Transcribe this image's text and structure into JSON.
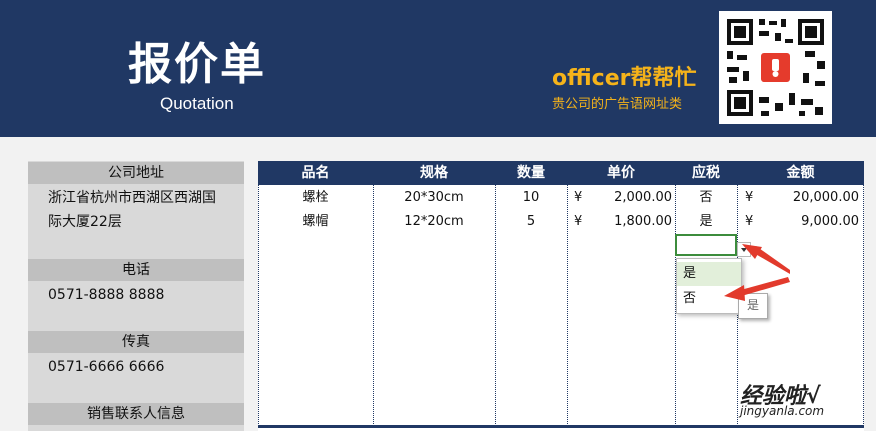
{
  "header": {
    "title_cn": "报价单",
    "title_en": "Quotation",
    "brand": "officer帮帮忙",
    "slogan": "贵公司的广告语网址类",
    "brand_color": "#f5b31a",
    "bg_color": "#203864"
  },
  "left": {
    "address_label": "公司地址",
    "address_line1": "浙江省杭州市西湖区西湖国",
    "address_line2": "际大厦22层",
    "phone_label": "电话",
    "phone": "0571-8888 8888",
    "fax_label": "传真",
    "fax": "0571-6666 6666",
    "sales_label": "销售联系人信息"
  },
  "table": {
    "headers": [
      "品名",
      "规格",
      "数量",
      "单价",
      "应税",
      "金额"
    ],
    "rows": [
      {
        "name": "螺栓",
        "spec": "20*30cm",
        "qty": "10",
        "cur1": "¥",
        "price": "2,000.00",
        "tax": "否",
        "cur2": "¥",
        "amount": "20,000.00"
      },
      {
        "name": "螺帽",
        "spec": "12*20cm",
        "qty": "5",
        "cur1": "¥",
        "price": "1,800.00",
        "tax": "是",
        "cur2": "¥",
        "amount": "9,000.00"
      }
    ]
  },
  "dropdown": {
    "options": [
      "是",
      "否"
    ],
    "highlighted": "是",
    "tooltip": "是"
  },
  "watermark": {
    "line1": "经验啦√",
    "line2": "jingyanla.com"
  }
}
